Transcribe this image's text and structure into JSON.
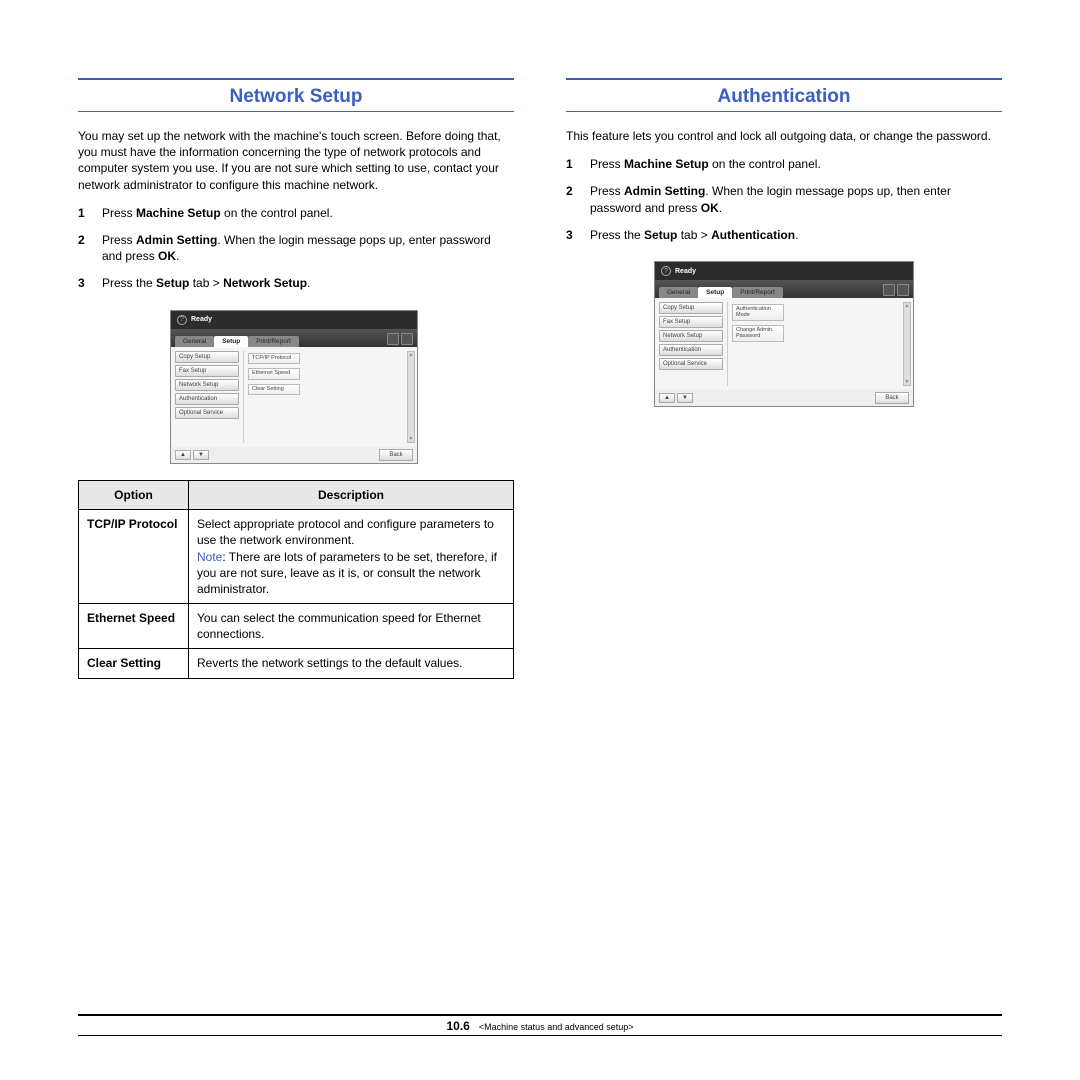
{
  "left": {
    "heading": "Network Setup",
    "intro": "You may set up the network with the machine's touch screen. Before doing that, you must have the information concerning the type of network protocols and computer system you use. If you are not sure which setting to use, contact your network administrator to configure this machine network.",
    "step1_a": "Press ",
    "step1_b": "Machine Setup",
    "step1_c": " on the control panel.",
    "step2_a": "Press ",
    "step2_b": "Admin Setting",
    "step2_c": ". When the login message pops up, enter password and press ",
    "step2_d": "OK",
    "step2_e": ".",
    "step3_a": "Press the ",
    "step3_b": "Setup",
    "step3_c": " tab > ",
    "step3_d": "Network Setup",
    "step3_e": ".",
    "ss": {
      "ready": "Ready",
      "tabs": {
        "general": "General",
        "setup": "Setup",
        "print": "Print/Report"
      },
      "side": [
        "Copy Setup",
        "Fax Setup",
        "Network Setup",
        "Authentication",
        "Optional Service"
      ],
      "items": [
        "TCP/IP\nProtocol",
        "Ethernet\nSpeed",
        "Clear\nSetting"
      ],
      "back": "Back"
    },
    "table": {
      "h1": "Option",
      "h2": "Description",
      "r1o": "TCP/IP Protocol",
      "r1d_a": "Select appropriate protocol and configure parameters to use the network environment.",
      "r1d_note": "Note",
      "r1d_b": ": There are lots of parameters to be set, therefore, if you are not sure, leave as it is, or consult the network administrator.",
      "r2o": "Ethernet Speed",
      "r2d": "You can select the communication speed for Ethernet connections.",
      "r3o": "Clear Setting",
      "r3d": "Reverts the network settings to the default values."
    }
  },
  "right": {
    "heading": "Authentication",
    "intro": "This feature lets you control and lock all outgoing data, or change the password.",
    "step1_a": "Press ",
    "step1_b": "Machine Setup",
    "step1_c": " on the control panel.",
    "step2_a": "Press ",
    "step2_b": "Admin Setting",
    "step2_c": ". When the login message pops up, then enter password and press ",
    "step2_d": "OK",
    "step2_e": ".",
    "step3_a": "Press the ",
    "step3_b": "Setup",
    "step3_c": " tab > ",
    "step3_d": "Authentication",
    "step3_e": ".",
    "ss": {
      "ready": "Ready",
      "tabs": {
        "general": "General",
        "setup": "Setup",
        "print": "Print/Report"
      },
      "side": [
        "Copy Setup",
        "Fax Setup",
        "Network Setup",
        "Authentication",
        "Optional Service"
      ],
      "items": [
        "Authentication\nMode",
        "Change Admin.\nPassword"
      ],
      "back": "Back"
    }
  },
  "footer": {
    "page": "10.6",
    "chapter": "<Machine status and advanced setup>"
  }
}
